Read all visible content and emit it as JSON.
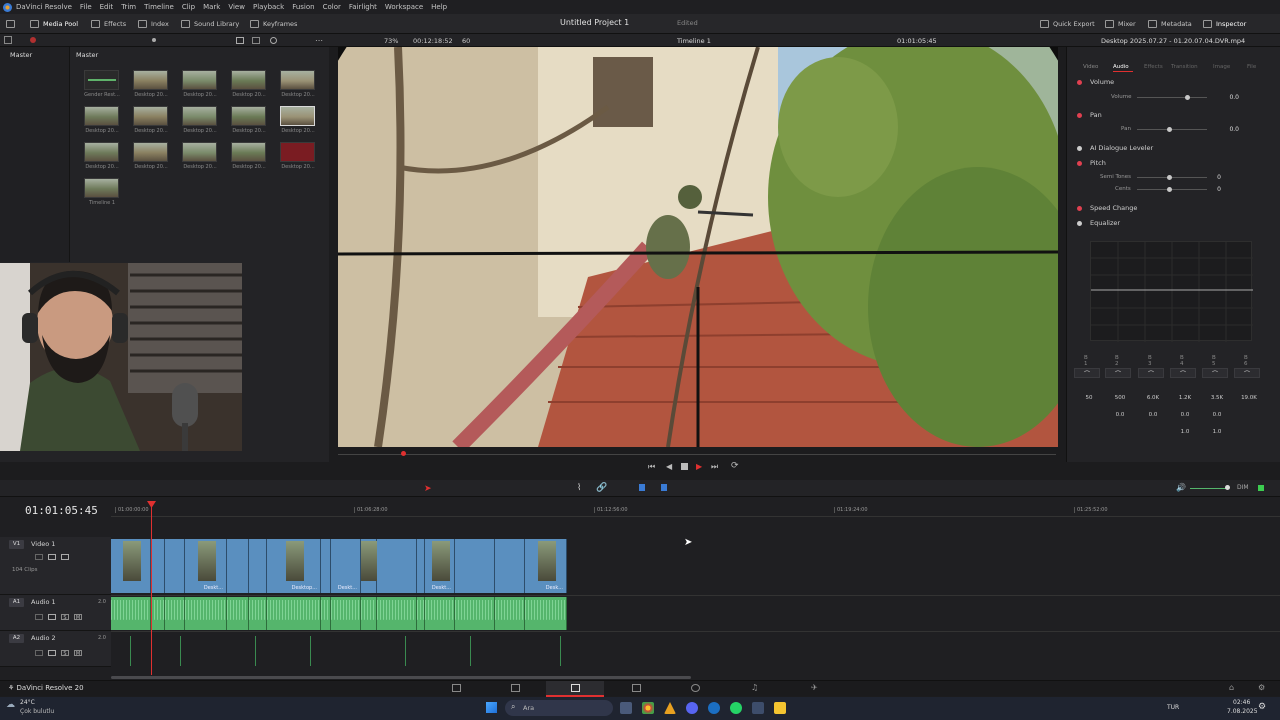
{
  "menubar": {
    "app_name": "DaVinci Resolve",
    "items": [
      "File",
      "Edit",
      "Trim",
      "Timeline",
      "Clip",
      "Mark",
      "View",
      "Playback",
      "Fusion",
      "Color",
      "Fairlight",
      "Workspace",
      "Help"
    ]
  },
  "toolbar": {
    "left": [
      "Media Pool",
      "Effects",
      "Index",
      "Sound Library",
      "Keyframes"
    ],
    "project_title": "Untitled Project 1",
    "project_status": "Edited",
    "right": [
      "Quick Export",
      "Mixer",
      "Metadata",
      "Inspector"
    ]
  },
  "subbar": {
    "zoom": "73%",
    "timecode": "00:12:18:52",
    "fps": "60",
    "timeline_name": "Timeline 1",
    "viewer_timecode": "01:01:05:45",
    "clip_name": "Desktop 2025.07.27 - 01.20.07.04.DVR.mp4"
  },
  "media_pool": {
    "bin_header": "Master",
    "grid_header": "Master",
    "clips": [
      {
        "label": "Gender Rest..."
      },
      {
        "label": "Desktop 20..."
      },
      {
        "label": "Desktop 20..."
      },
      {
        "label": "Desktop 20..."
      },
      {
        "label": "Desktop 20..."
      },
      {
        "label": "Desktop 20..."
      },
      {
        "label": "Desktop 20..."
      },
      {
        "label": "Desktop 20..."
      },
      {
        "label": "Desktop 20..."
      },
      {
        "label": "Desktop 20..."
      },
      {
        "label": "Desktop 20..."
      },
      {
        "label": "Desktop 20..."
      },
      {
        "label": "Desktop 20..."
      },
      {
        "label": "Desktop 20..."
      },
      {
        "label": "Desktop 20..."
      },
      {
        "label": "Timeline 1"
      }
    ]
  },
  "inspector": {
    "tabs": [
      "Video",
      "Audio",
      "Effects",
      "Transition",
      "Image",
      "File"
    ],
    "active_tab": "Audio",
    "volume": {
      "title": "Volume",
      "param": "Volume",
      "value": "0.0"
    },
    "pan": {
      "title": "Pan",
      "param": "Pan",
      "value": "0.0"
    },
    "dialogue": {
      "title": "AI Dialogue Leveler"
    },
    "pitch": {
      "title": "Pitch",
      "semitones_label": "Semi Tones",
      "semitones": "0",
      "cents_label": "Cents",
      "cents": "0"
    },
    "speed": {
      "title": "Speed Change"
    },
    "eq": {
      "title": "Equalizer",
      "bands": [
        "B 1",
        "B 2",
        "B 3",
        "B 4",
        "B 5",
        "B 6"
      ],
      "freq": [
        "50",
        "500",
        "6.0K",
        "1.2K",
        "3.5K",
        "19.0K"
      ],
      "gain": [
        "0.0",
        "0.0",
        "0.0",
        "0.0"
      ],
      "q": [
        "1.0",
        "1.0"
      ]
    }
  },
  "timeline": {
    "timecode": "01:01:05:45",
    "ruler": [
      "01:00:00:00",
      "01:06:28:00",
      "01:12:56:00",
      "01:19:24:00",
      "01:25:52:00"
    ],
    "tracks": [
      {
        "tag": "V1",
        "name": "Video 1",
        "info": "104 Clips"
      },
      {
        "tag": "A1",
        "name": "Audio 1",
        "info": "2.0"
      },
      {
        "tag": "A2",
        "name": "Audio 2",
        "info": "2.0"
      }
    ],
    "clip_labels": [
      "Deskt...",
      "Desktop...",
      "Deskt...",
      "Deskt...",
      "Desk..."
    ]
  },
  "pagebar": {
    "app": "DaVinci Resolve 20"
  },
  "taskbar": {
    "weather_temp": "24°C",
    "weather_desc": "Çok bulutlu",
    "search_placeholder": "Ara",
    "lang": "TUR",
    "time": "02:46",
    "date": "7.08.2025"
  },
  "colors": {
    "accent": "#e03030",
    "video_clip": "#5a8fbf",
    "audio_clip": "#55b56c"
  }
}
